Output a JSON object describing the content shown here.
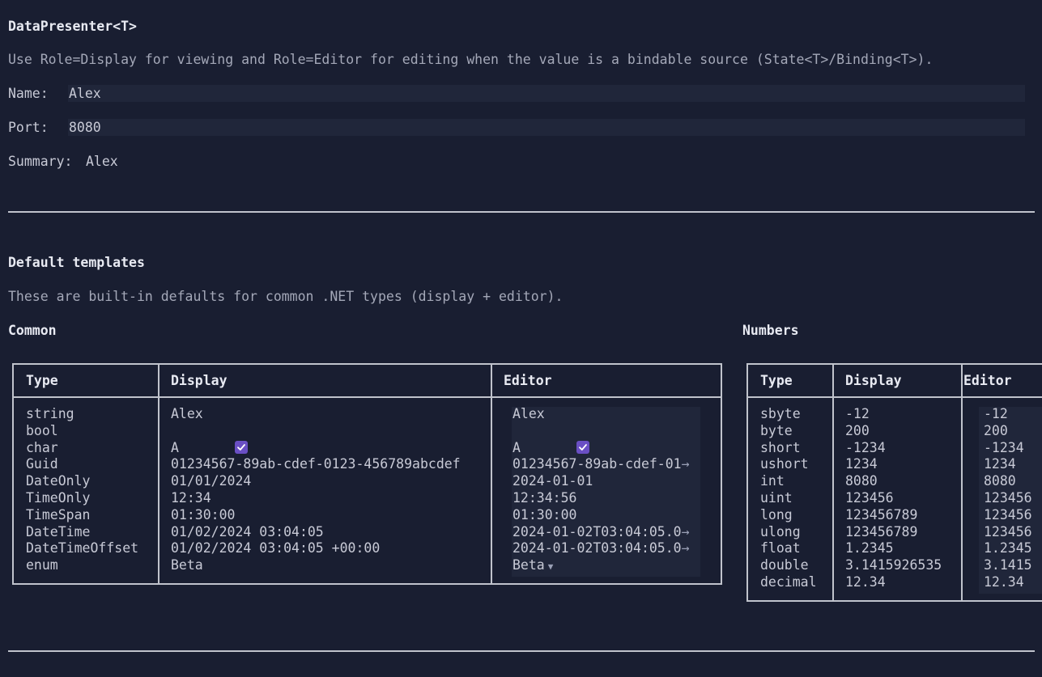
{
  "presenter": {
    "title": "DataPresenter<T>",
    "description": "Use Role=Display for viewing and Role=Editor for editing when the value is a bindable source (State<T>/Binding<T>).",
    "name_label": "Name:",
    "name_value": "Alex",
    "port_label": "Port:",
    "port_value": "8080",
    "summary_label": "Summary:",
    "summary_value": "Alex"
  },
  "defaults": {
    "title": "Default templates",
    "description": "These are built-in defaults for common .NET types (display + editor)."
  },
  "common": {
    "heading": "Common",
    "headers": [
      "Type",
      "Display",
      "Editor"
    ],
    "rows": [
      {
        "type": "string",
        "display": "Alex",
        "editor": "Alex"
      },
      {
        "type": "bool",
        "display": "",
        "editor": ""
      },
      {
        "type": "char",
        "display": "A",
        "editor": "A"
      },
      {
        "type": "Guid",
        "display": "01234567-89ab-cdef-0123-456789abcdef",
        "editor": "01234567-89ab-cdef-01"
      },
      {
        "type": "DateOnly",
        "display": "01/01/2024",
        "editor": "2024-01-01"
      },
      {
        "type": "TimeOnly",
        "display": "12:34",
        "editor": "12:34:56"
      },
      {
        "type": "TimeSpan",
        "display": "01:30:00",
        "editor": "01:30:00"
      },
      {
        "type": "DateTime",
        "display": "01/02/2024 03:04:05",
        "editor": "2024-01-02T03:04:05.0"
      },
      {
        "type": "DateTimeOffset",
        "display": "01/02/2024 03:04:05 +00:00",
        "editor": "2024-01-02T03:04:05.0"
      },
      {
        "type": "enum",
        "display": "Beta",
        "editor": "Beta"
      }
    ]
  },
  "numbers": {
    "heading": "Numbers",
    "headers": [
      "Type",
      "Display",
      "Editor"
    ],
    "rows": [
      {
        "type": "sbyte",
        "display": "-12",
        "editor": "-12"
      },
      {
        "type": "byte",
        "display": "200",
        "editor": "200"
      },
      {
        "type": "short",
        "display": "-1234",
        "editor": "-1234"
      },
      {
        "type": "ushort",
        "display": "1234",
        "editor": "1234"
      },
      {
        "type": "int",
        "display": "8080",
        "editor": "8080"
      },
      {
        "type": "uint",
        "display": "123456",
        "editor": "123456"
      },
      {
        "type": "long",
        "display": "123456789",
        "editor": "123456"
      },
      {
        "type": "ulong",
        "display": "123456789",
        "editor": "123456"
      },
      {
        "type": "float",
        "display": "1.2345",
        "editor": "1.2345"
      },
      {
        "type": "double",
        "display": "3.1415926535",
        "editor": "3.1415"
      },
      {
        "type": "decimal",
        "display": "12.34",
        "editor": "12.34"
      }
    ]
  },
  "icons": {
    "check": "check-icon",
    "overflow": "arrow-right-icon",
    "dropdown": "caret-down-icon"
  },
  "colors": {
    "background": "#191e31",
    "field": "#20263a",
    "accent": "#6a4fc4",
    "border": "#c0c3cc"
  }
}
